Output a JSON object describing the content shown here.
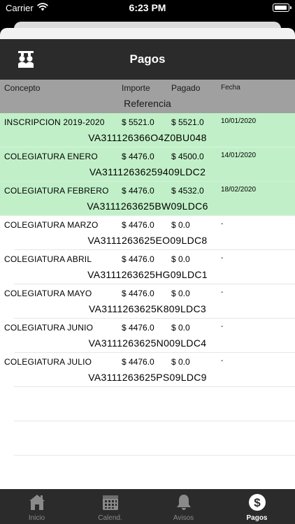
{
  "status_bar": {
    "carrier": "Carrier",
    "time": "6:23 PM"
  },
  "header": {
    "title": "Pagos"
  },
  "columns": {
    "concepto": "Concepto",
    "importe": "Importe",
    "pagado": "Pagado",
    "fecha": "Fecha",
    "referencia": "Referencia"
  },
  "payments": [
    {
      "concepto": "INSCRIPCION 2019-2020",
      "importe": "$ 5521.0",
      "pagado": "$ 5521.0",
      "fecha": "10/01/2020",
      "referencia": "VA311126366O4Z0BU048",
      "paid": true
    },
    {
      "concepto": "COLEGIATURA ENERO",
      "importe": "$ 4476.0",
      "pagado": "$ 4500.0",
      "fecha": "14/01/2020",
      "referencia": "VA31112636259409LDC2",
      "paid": true
    },
    {
      "concepto": "COLEGIATURA FEBRERO",
      "importe": "$ 4476.0",
      "pagado": "$ 4532.0",
      "fecha": "18/02/2020",
      "referencia": "VA3111263625BW09LDC6",
      "paid": true
    },
    {
      "concepto": "COLEGIATURA  MARZO",
      "importe": "$ 4476.0",
      "pagado": "$ 0.0",
      "fecha": "-",
      "referencia": "VA3111263625EO09LDC8",
      "paid": false
    },
    {
      "concepto": "COLEGIATURA  ABRIL",
      "importe": "$ 4476.0",
      "pagado": "$ 0.0",
      "fecha": "-",
      "referencia": "VA3111263625HG09LDC1",
      "paid": false
    },
    {
      "concepto": "COLEGIATURA MAYO",
      "importe": "$ 4476.0",
      "pagado": "$ 0.0",
      "fecha": "-",
      "referencia": "VA3111263625K809LDC3",
      "paid": false
    },
    {
      "concepto": "COLEGIATURA JUNIO",
      "importe": "$ 4476.0",
      "pagado": "$ 0.0",
      "fecha": "-",
      "referencia": "VA3111263625N009LDC4",
      "paid": false
    },
    {
      "concepto": "COLEGIATURA  JULIO",
      "importe": "$ 4476.0",
      "pagado": "$ 0.0",
      "fecha": "-",
      "referencia": "VA3111263625PS09LDC9",
      "paid": false
    }
  ],
  "colors": {
    "paid_row": "#c1f0c8",
    "header_bg": "#2b2b2b",
    "column_header_bg": "#a0a0a0"
  },
  "tabs": [
    {
      "label": "Inicio",
      "icon": "home-icon",
      "active": false
    },
    {
      "label": "Calend.",
      "icon": "calendar-icon",
      "active": false
    },
    {
      "label": "Avisos",
      "icon": "bell-icon",
      "active": false
    },
    {
      "label": "Pagos",
      "icon": "dollar-icon",
      "active": true
    }
  ]
}
